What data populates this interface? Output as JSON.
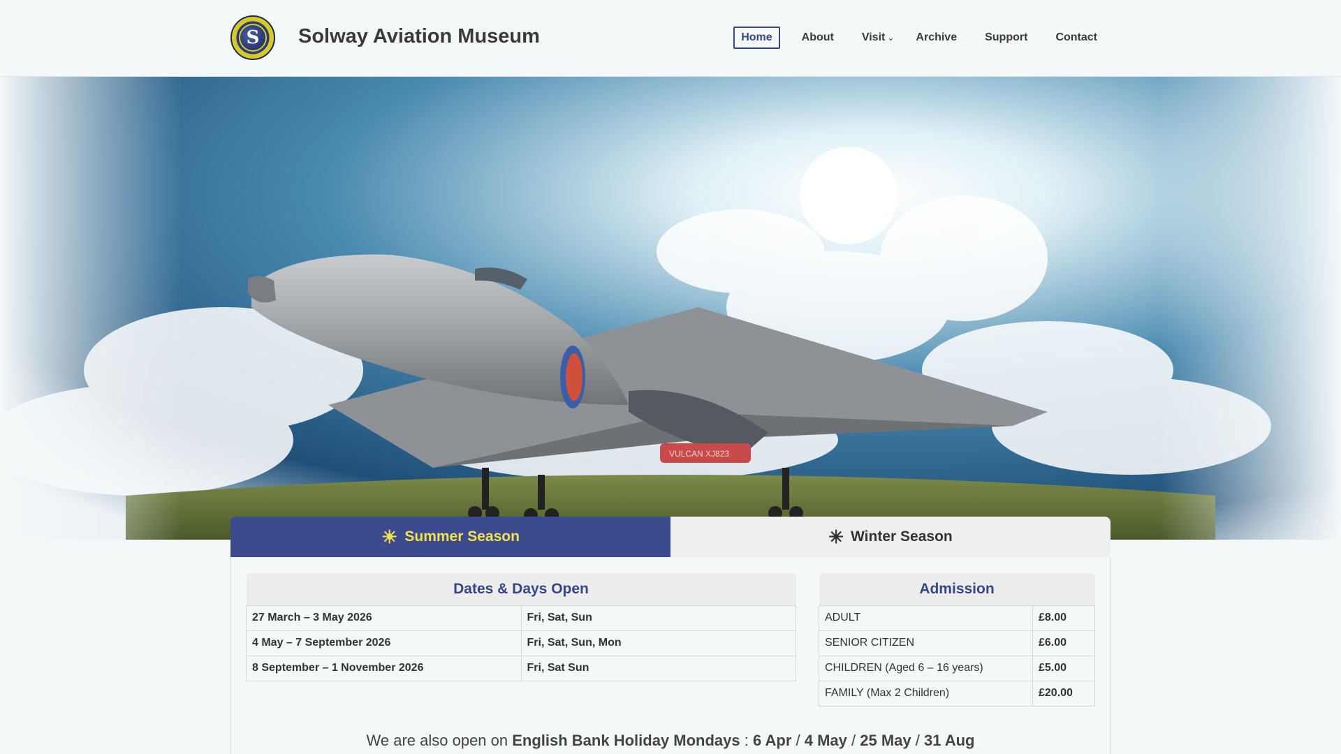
{
  "header": {
    "title": "Solway Aviation Museum",
    "logo_letter": "S",
    "nav": [
      {
        "label": "Home",
        "active": true
      },
      {
        "label": "About"
      },
      {
        "label": "Visit",
        "has_dropdown": true
      },
      {
        "label": "Archive"
      },
      {
        "label": "Support"
      },
      {
        "label": "Contact"
      }
    ],
    "dropdown_icon": "⌄"
  },
  "hero": {
    "aircraft_marking": "VULCAN     XJ823"
  },
  "tabs": {
    "summer": {
      "label": "Summer Season",
      "icon": "☀"
    },
    "winter": {
      "label": "Winter Season",
      "icon": "✳"
    }
  },
  "dates_table": {
    "heading": "Dates & Days Open",
    "rows": [
      {
        "dates": "27 March – 3 May 2026",
        "days": "Fri, Sat, Sun"
      },
      {
        "dates": "4 May – 7 September 2026",
        "days": "Fri, Sat, Sun, Mon"
      },
      {
        "dates": "8 September – 1 November 2026",
        "days": "Fri, Sat Sun"
      }
    ]
  },
  "admission_table": {
    "heading": "Admission",
    "rows": [
      {
        "type": "ADULT",
        "price": "£8.00"
      },
      {
        "type": "SENIOR CITIZEN",
        "price": "£6.00"
      },
      {
        "type": "CHILDREN (Aged 6 – 16 years)",
        "price": "£5.00"
      },
      {
        "type": "FAMILY (Max 2 Children)",
        "price": "£20.00"
      }
    ]
  },
  "holiday_note": {
    "prefix": "We are also open on ",
    "bold": "English Bank Holiday Mondays",
    "sep": " : ",
    "dates": [
      "6 Apr",
      "4 May",
      "25 May",
      "31 Aug"
    ],
    "divider": " / "
  },
  "colors": {
    "accent": "#34468c",
    "summer_tab_bg": "#3c4a8e",
    "summer_tab_text": "#f1e34a",
    "winter_tab_bg": "#efefef"
  }
}
